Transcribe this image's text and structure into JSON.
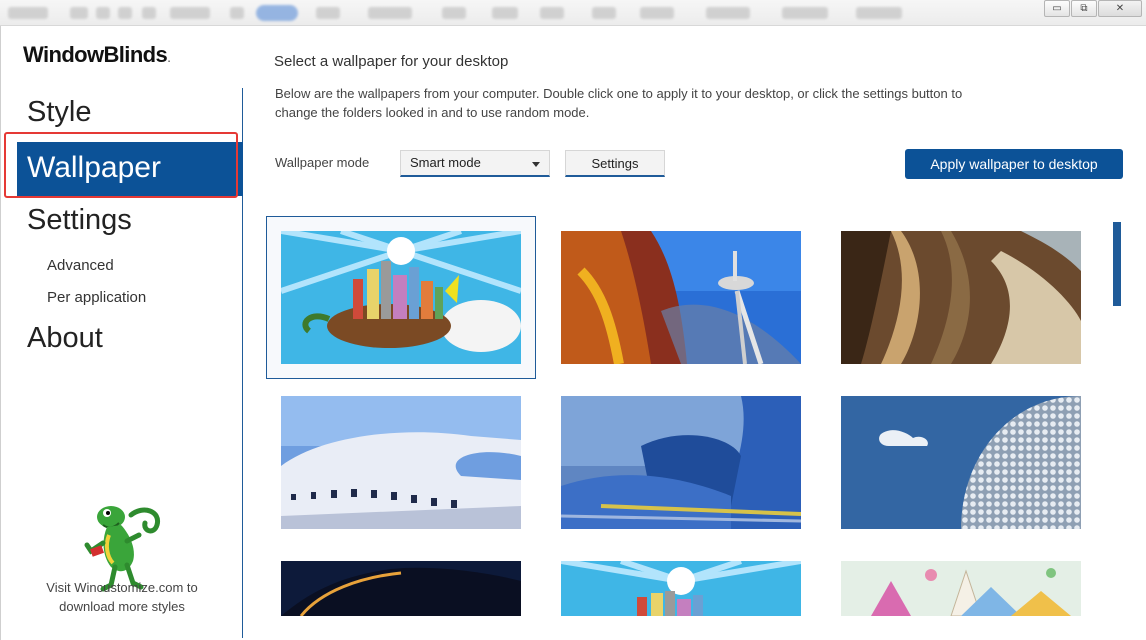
{
  "app": {
    "logo": "WindowBlinds",
    "logo_mark": "."
  },
  "window_controls": {
    "minimize_icon": "minimize-icon",
    "restore_icon": "restore-icon",
    "close_icon": "close-icon"
  },
  "nav": {
    "style": "Style",
    "wallpaper": "Wallpaper",
    "settings": "Settings",
    "advanced": "Advanced",
    "per_application": "Per application",
    "about": "About"
  },
  "promo": {
    "line1": "Visit Wincustomize.com to",
    "line2": "download more styles"
  },
  "main": {
    "heading": "Select a wallpaper for your desktop",
    "description": "Below are the wallpapers from your computer.  Double click one to apply it to your desktop, or click the settings button to change the folders looked in and to use random mode.",
    "mode_label": "Wallpaper mode",
    "mode_value": "Smart mode",
    "settings_button": "Settings",
    "apply_button": "Apply wallpaper to desktop"
  },
  "wallpapers": [
    {
      "name": "turtle-city-wallpaper",
      "selected": true
    },
    {
      "name": "space-needle-wallpaper",
      "selected": false
    },
    {
      "name": "metal-curves-wallpaper",
      "selected": false
    },
    {
      "name": "white-building-wallpaper",
      "selected": false
    },
    {
      "name": "blue-architecture-wallpaper",
      "selected": false
    },
    {
      "name": "silver-dome-wallpaper",
      "selected": false
    },
    {
      "name": "night-arch-wallpaper",
      "selected": false
    },
    {
      "name": "turtle-city-duplicate-wallpaper",
      "selected": false
    },
    {
      "name": "fantasy-tents-wallpaper",
      "selected": false
    }
  ],
  "colors": {
    "accent": "#0c5297",
    "highlight_border": "#e53935"
  }
}
